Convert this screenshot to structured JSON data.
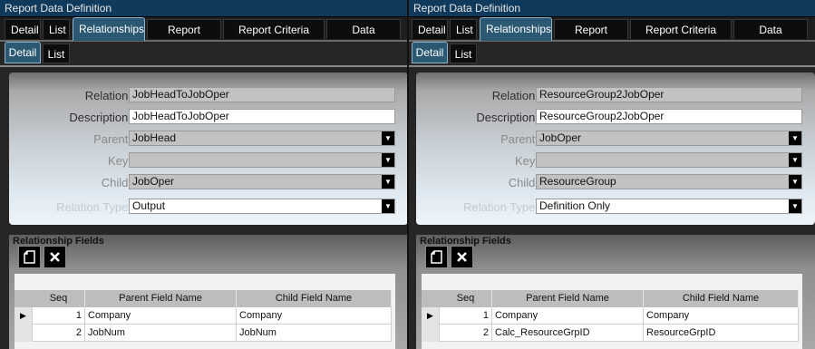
{
  "panels": [
    {
      "window_title": "Report Data Definition",
      "tabs": [
        "Detail",
        "List",
        "Relationships",
        "Report Labels",
        "Report Criteria Sets",
        "Data Sources"
      ],
      "active_tab": "Relationships",
      "subtabs": [
        "Detail",
        "List"
      ],
      "active_subtab": "Detail",
      "form": {
        "relation_label": "Relation:",
        "relation_value": "JobHeadToJobOper",
        "description_label": "Description:",
        "description_value": "JobHeadToJobOper",
        "parent_label": "Parent:",
        "parent_value": "JobHead",
        "key_label": "Key:",
        "key_value": "",
        "child_label": "Child:",
        "child_value": "JobOper",
        "relation_type_label": "Relation Type:",
        "relation_type_value": "Output"
      },
      "relationship_fields": {
        "title": "Relationship Fields",
        "columns": [
          "Seq",
          "Parent Field Name",
          "Child Field Name"
        ],
        "rows": [
          {
            "seq": "1",
            "parent": "Company",
            "child": "Company"
          },
          {
            "seq": "2",
            "parent": "JobNum",
            "child": "JobNum"
          }
        ]
      }
    },
    {
      "window_title": "Report Data Definition",
      "tabs": [
        "Detail",
        "List",
        "Relationships",
        "Report Labels",
        "Report Criteria Sets",
        "Data Sources"
      ],
      "active_tab": "Relationships",
      "subtabs": [
        "Detail",
        "List"
      ],
      "active_subtab": "Detail",
      "form": {
        "relation_label": "Relation:",
        "relation_value": "ResourceGroup2JobOper",
        "description_label": "Description:",
        "description_value": "ResourceGroup2JobOper",
        "parent_label": "Parent:",
        "parent_value": "JobOper",
        "key_label": "Key:",
        "key_value": "",
        "child_label": "Child:",
        "child_value": "ResourceGroup",
        "relation_type_label": "Relation Type:",
        "relation_type_value": "Definition Only"
      },
      "relationship_fields": {
        "title": "Relationship Fields",
        "columns": [
          "Seq",
          "Parent Field Name",
          "Child Field Name"
        ],
        "rows": [
          {
            "seq": "1",
            "parent": "Company",
            "child": "Company"
          },
          {
            "seq": "2",
            "parent": "Calc_ResourceGrpID",
            "child": "ResourceGrpID"
          }
        ]
      }
    }
  ],
  "icons": {
    "new": "new-document-icon",
    "delete": "delete-x-icon",
    "dropdown": "chevron-down-icon",
    "row_pointer": "row-pointer-icon"
  },
  "colors": {
    "title_bar": "#0f3a5c",
    "active_tab": "#2b5873"
  }
}
